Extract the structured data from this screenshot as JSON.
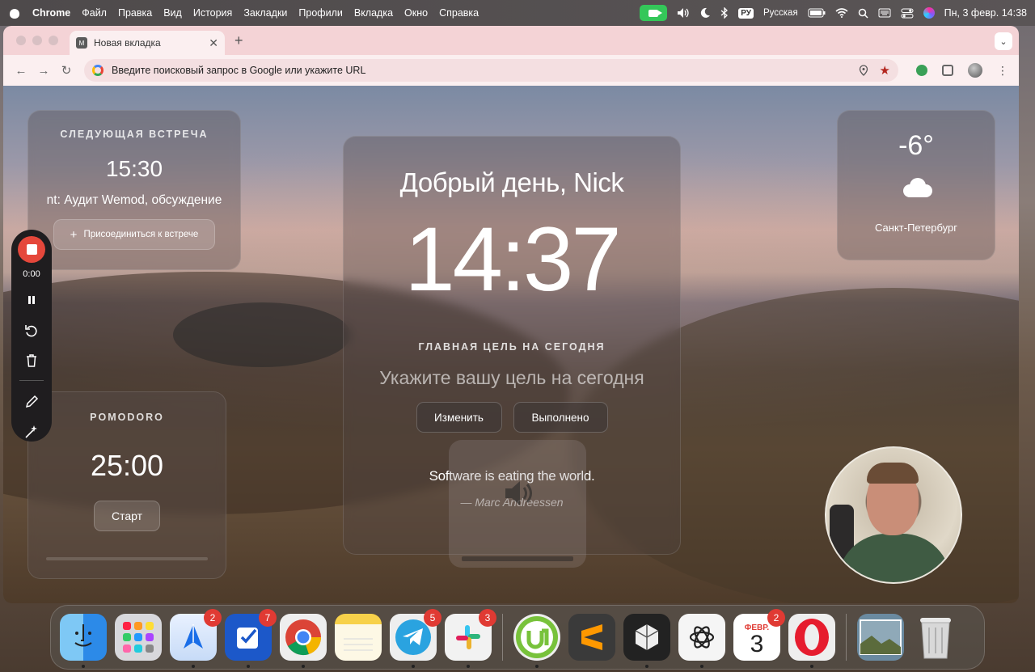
{
  "menubar": {
    "app": "Chrome",
    "items": [
      "Файл",
      "Правка",
      "Вид",
      "История",
      "Закладки",
      "Профили",
      "Вкладка",
      "Окно",
      "Справка"
    ],
    "input_source_badge": "РУ",
    "input_source": "Русская",
    "datetime": "Пн, 3 февр.  14:38"
  },
  "browser": {
    "tab_title": "Новая вкладка",
    "tab_favicon": "M",
    "address_placeholder": "Введите поисковый запрос в Google или укажите URL"
  },
  "meeting": {
    "label": "СЛЕДУЮЩАЯ ВСТРЕЧА",
    "time": "15:30",
    "title": "nt: Аудит Wemod, обсуждение",
    "join_label": "Присоединиться к встрече"
  },
  "main": {
    "greeting": "Добрый день, Nick",
    "clock": "14:37",
    "goal_label": "ГЛАВНАЯ ЦЕЛЬ НА СЕГОДНЯ",
    "goal_placeholder": "Укажите вашу цель на сегодня",
    "edit_label": "Изменить",
    "done_label": "Выполнено",
    "quote": "Software is eating the world.",
    "author": "— Marc Andreessen"
  },
  "weather": {
    "temp": "-6°",
    "city": "Санкт-Петербург",
    "icon": "cloud-icon"
  },
  "pomodoro": {
    "label": "POMODORO",
    "time": "25:00",
    "start_label": "Старт"
  },
  "recorder": {
    "elapsed": "0:00"
  },
  "dock": {
    "spark_badge": "2",
    "things_badge": "7",
    "telegram_badge": "5",
    "slack_badge": "3",
    "calendar_month": "ФЕВР.",
    "calendar_day": "3",
    "calendar_badge": "2"
  },
  "colors": {
    "record_red": "#e5473b",
    "tab_strip": "#f4d3d6",
    "badge_red": "#e03a33",
    "facetime_green": "#34c759"
  }
}
